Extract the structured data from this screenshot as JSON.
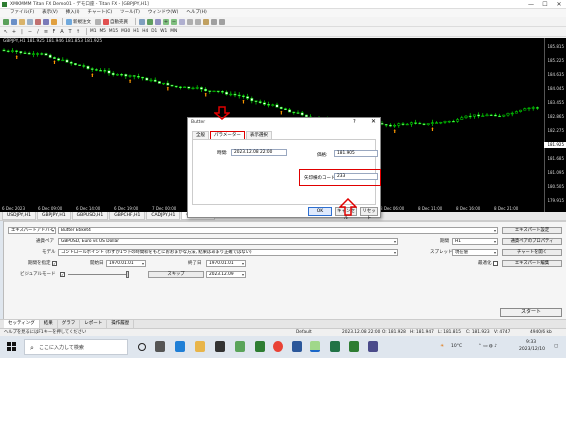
{
  "window": {
    "title": "XMKMMM Titan FX Demo01 - デモ口座 - Titan FX - [GBPJPY,H1]",
    "min_glyph": "—",
    "max_glyph": "☐",
    "close_glyph": "✕"
  },
  "menu": [
    "ファイル(F)",
    "表示(V)",
    "挿入(I)",
    "チャート(C)",
    "ツール(T)",
    "ウィンドウ(W)",
    "ヘルプ(H)"
  ],
  "toolbar": {
    "new_order": "新規注文",
    "auto_trade": "自動売買",
    "timeframes": [
      "M1",
      "M5",
      "M15",
      "M30",
      "H1",
      "H4",
      "D1",
      "W1",
      "MN"
    ]
  },
  "chart": {
    "title": "GBPJPY,H1 181.925 181.946 181.853 181.925",
    "price_labels": [
      "185.815",
      "185.225",
      "184.635",
      "184.045",
      "183.455",
      "182.865",
      "182.275",
      "181.925",
      "181.685",
      "181.095",
      "180.505",
      "179.915"
    ],
    "highlight_price": "181.925",
    "time_labels": [
      "6 Dec 2023",
      "6 Dec 09:00",
      "6 Dec 14:00",
      "6 Dec 19:00",
      "7 Dec 00:00",
      "7 Dec 05:00",
      "7 Dec 10:00",
      "7 Dec 15:00",
      "7 Dec 20:00",
      "8 Dec 01:00",
      "8 Dec 06:00",
      "8 Dec 11:00",
      "8 Dec 16:00",
      "8 Dec 21:00"
    ],
    "colors": {
      "up": "#00e600",
      "down": "#ffffff",
      "arrow": "#ff9900",
      "background": "#000000"
    }
  },
  "chart_tabs": [
    "USDJPY,H1",
    "GBPJPY,H1",
    "GBPUSD,H1",
    "GBPCHF,H1",
    "CADJPY,H1",
    "GBPJPY,H1"
  ],
  "tester": {
    "ea_type": "エキスパートアドバイザ",
    "ea_name": "Butter Etiket4",
    "symbol_label": "通貨ペア",
    "symbol_value": "GBPUSD, Euro vs US Dollar",
    "model_label": "モデル",
    "model_value": "コントロールポイント (わずか1つ下の時間枠をもとにおおまかな方法, 結果はあまり正確ではない)",
    "date_use_label": "期間を指定",
    "from_label": "開始日",
    "from_value": "1970.01.01",
    "to_label": "終了日",
    "to_value": "1970.01.01",
    "visual_label": "ビジュアルモード",
    "skip_label": "スキップ",
    "skip_value": "2023.12.09",
    "period_label": "期間",
    "period_value": "H1",
    "spread_label": "スプレッド",
    "spread_value": "現在値",
    "optimize_label": "最適化",
    "btn_ea_props": "エキスパート設定",
    "btn_symbol_props": "通貨ペアのプロパティ",
    "btn_open_chart": "チャートを開く",
    "btn_modify_ea": "エキスパート編集",
    "start_label": "スタート"
  },
  "bottom_tabs": [
    "セッティング",
    "結果",
    "グラフ",
    "レポート",
    "操作履歴"
  ],
  "statusbar": {
    "help": "ヘルプを見るにはF1キーを押してください",
    "profile": "Default",
    "datetime": "2023.12.08 22:00",
    "open": "O: 181.928",
    "high": "H: 181.947",
    "low": "L: 181.815",
    "close": "C: 181.923",
    "volume": "V: 4747",
    "traffic": "4940/6 kb"
  },
  "dialog": {
    "title": "Butter",
    "help": "?",
    "close": "✕",
    "tabs": [
      "全般",
      "パラメーター",
      "表示選択"
    ],
    "time_label": "時間:",
    "time_value": "2023.12.08 22:00",
    "price_label": "価格:",
    "price_value": "181.905",
    "code_label": "矢印横のコード:",
    "code_value": "233",
    "ok": "OK",
    "cancel": "キャンセル",
    "reset": "リセット"
  },
  "taskbar": {
    "search_placeholder": "ここに入力して検索",
    "weather": "10°C",
    "time": "9:33",
    "date": "2023/12/10"
  }
}
